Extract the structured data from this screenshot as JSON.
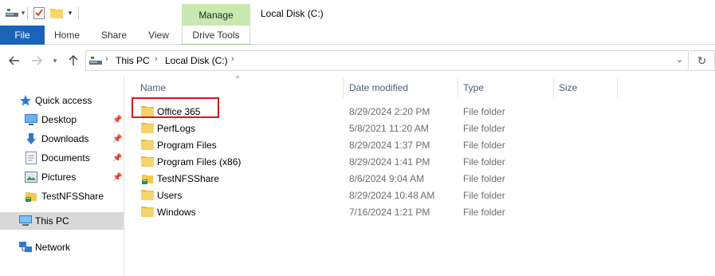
{
  "window": {
    "title": "Local Disk (C:)",
    "contextual_tab_group": "Manage"
  },
  "ribbon": {
    "tabs": [
      {
        "label": "File"
      },
      {
        "label": "Home"
      },
      {
        "label": "Share"
      },
      {
        "label": "View"
      },
      {
        "label": "Drive Tools"
      }
    ]
  },
  "address": {
    "crumbs": [
      "This PC",
      "Local Disk (C:)"
    ]
  },
  "nav": {
    "items": [
      {
        "label": "Quick access",
        "icon": "star-icon"
      },
      {
        "label": "Desktop",
        "icon": "desktop-icon",
        "pinned": true
      },
      {
        "label": "Downloads",
        "icon": "download-icon",
        "pinned": true
      },
      {
        "label": "Documents",
        "icon": "documents-icon",
        "pinned": true
      },
      {
        "label": "Pictures",
        "icon": "pictures-icon",
        "pinned": true
      },
      {
        "label": "TestNFSShare",
        "icon": "share-folder-icon"
      },
      {
        "label": "This PC",
        "icon": "computer-icon",
        "selected": true
      },
      {
        "label": "Network",
        "icon": "network-icon"
      }
    ]
  },
  "columns": {
    "name": "Name",
    "date": "Date modified",
    "type": "Type",
    "size": "Size"
  },
  "files": [
    {
      "name": "Office 365",
      "date": "8/29/2024 2:20 PM",
      "type": "File folder",
      "size": "",
      "icon": "folder-icon",
      "highlighted": true
    },
    {
      "name": "PerfLogs",
      "date": "5/8/2021 11:20 AM",
      "type": "File folder",
      "size": "",
      "icon": "folder-icon"
    },
    {
      "name": "Program Files",
      "date": "8/29/2024 1:37 PM",
      "type": "File folder",
      "size": "",
      "icon": "folder-icon"
    },
    {
      "name": "Program Files (x86)",
      "date": "8/29/2024 1:41 PM",
      "type": "File folder",
      "size": "",
      "icon": "folder-icon"
    },
    {
      "name": "TestNFSShare",
      "date": "8/6/2024 9:04 AM",
      "type": "File folder",
      "size": "",
      "icon": "share-folder-icon"
    },
    {
      "name": "Users",
      "date": "8/29/2024 10:48 AM",
      "type": "File folder",
      "size": "",
      "icon": "folder-icon"
    },
    {
      "name": "Windows",
      "date": "7/16/2024 1:21 PM",
      "type": "File folder",
      "size": "",
      "icon": "folder-icon"
    }
  ],
  "colors": {
    "file_tab": "#1a63b6",
    "manage_tab": "#c9e7b0",
    "highlight_border": "#d0191b",
    "folder": "#f2c94c",
    "selected_nav": "#d9d9d9"
  }
}
